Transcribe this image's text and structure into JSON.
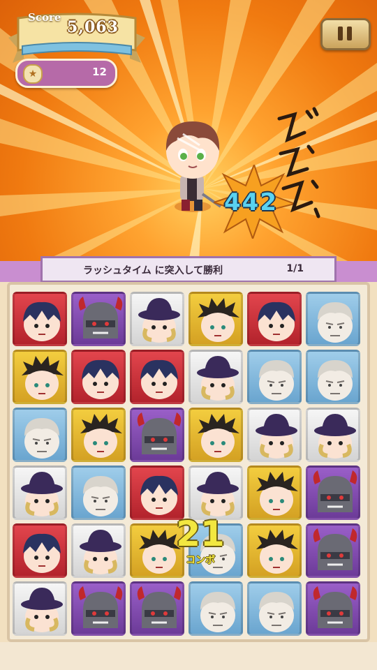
{
  "hud": {
    "score_label": "Score",
    "score_value": "5,063",
    "coin_icon": "coin-icon",
    "coin_count": "12",
    "pause_icon": "pause-icon"
  },
  "battle": {
    "damage_number": "442",
    "sound_effect": "ドドドドド"
  },
  "mission": {
    "text": "ラッシュタイム に突入して勝利",
    "progress": "1/1"
  },
  "combo": {
    "count": "21",
    "label": "コンボ"
  },
  "board": {
    "rows": 6,
    "cols": 6,
    "tiles": [
      [
        "red-vampire",
        "purple-helmet",
        "white-hatman",
        "yellow-spiky",
        "red-vampire",
        "blue-oldman"
      ],
      [
        "yellow-spiky",
        "red-vampire",
        "red-vampire",
        "white-hatman",
        "blue-oldman",
        "blue-oldman"
      ],
      [
        "blue-oldman",
        "yellow-spiky",
        "purple-helmet",
        "yellow-spiky",
        "white-hatman",
        "white-hatman"
      ],
      [
        "white-hatman",
        "blue-oldman",
        "red-vampire",
        "white-hatman",
        "yellow-spiky",
        "purple-helmet"
      ],
      [
        "red-vampire",
        "white-hatman",
        "yellow-spiky",
        "blue-oldman",
        "yellow-spiky",
        "purple-helmet"
      ],
      [
        "white-hatman",
        "purple-helmet",
        "purple-helmet",
        "blue-oldman",
        "blue-oldman",
        "purple-helmet"
      ]
    ]
  },
  "colors": {
    "stage_orange": "#f08a18",
    "frame_purple": "#a073ac",
    "combo_yellow": "#f2e740",
    "damage_blue": "#5ad2f0"
  }
}
